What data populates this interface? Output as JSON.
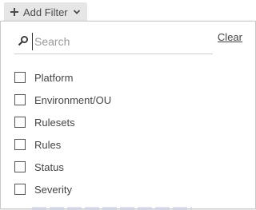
{
  "add_filter": {
    "label": "Add Filter"
  },
  "search": {
    "placeholder": "Search",
    "value": ""
  },
  "clear": {
    "label": "Clear"
  },
  "options": [
    {
      "label": "Platform",
      "checked": false
    },
    {
      "label": "Environment/OU",
      "checked": false
    },
    {
      "label": "Rulesets",
      "checked": false
    },
    {
      "label": "Rules",
      "checked": false
    },
    {
      "label": "Status",
      "checked": false
    },
    {
      "label": "Severity",
      "checked": false
    }
  ],
  "colors": {
    "button_bg": "#e6e6e6",
    "text": "#444444",
    "border": "#c9c9c9"
  }
}
